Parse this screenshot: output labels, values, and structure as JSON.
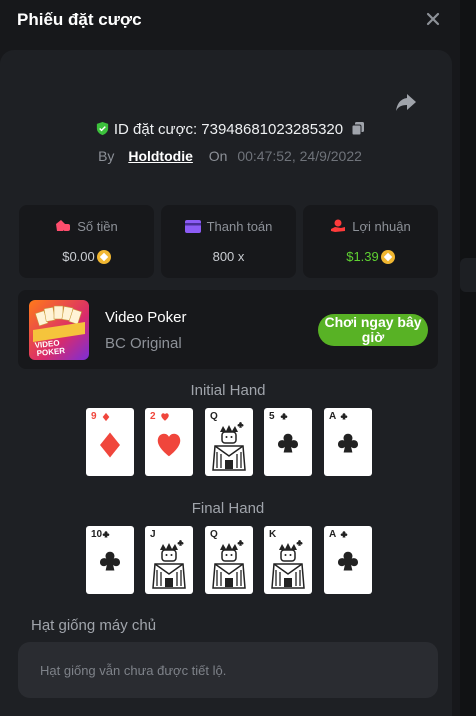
{
  "header": {
    "title": "Phiếu đặt cược",
    "close_icon": "close-icon"
  },
  "bet": {
    "share_icon": "share-icon",
    "verified_icon": "shield-check-icon",
    "copy_icon": "copy-icon",
    "id_label": "ID đặt cược:",
    "id_value": "73948681023285320",
    "by_label": "By",
    "user": "Holdtodie",
    "on_label": "On",
    "time": "00:47:52, 24/9/2022"
  },
  "stats": [
    {
      "icon": "money-bag-icon",
      "label": "Số tiền",
      "value": "$0.00",
      "coin": "coin-icon",
      "color": "#ff4d6d"
    },
    {
      "icon": "wallet-card-icon",
      "label": "Thanh toán",
      "value": "800 x",
      "color": "#8c5cf5"
    },
    {
      "icon": "hand-coin-icon",
      "label": "Lợi nhuận",
      "value": "$1.39",
      "coin": "coin-icon",
      "color": "#ff3b3b",
      "value_color": "#5fd132"
    }
  ],
  "game": {
    "name": "Video Poker",
    "provider": "BC Original",
    "thumb_text": [
      "VIDEO",
      "POKER"
    ],
    "play_label": "Chơi ngay bây giờ"
  },
  "hands": {
    "initial_label": "Initial Hand",
    "initial_cards": [
      {
        "rank": "9",
        "suit": "diamonds"
      },
      {
        "rank": "2",
        "suit": "hearts"
      },
      {
        "rank": "Q",
        "suit": "clubs"
      },
      {
        "rank": "5",
        "suit": "clubs"
      },
      {
        "rank": "A",
        "suit": "clubs"
      }
    ],
    "final_label": "Final Hand",
    "final_cards": [
      {
        "rank": "10",
        "suit": "clubs"
      },
      {
        "rank": "J",
        "suit": "clubs"
      },
      {
        "rank": "Q",
        "suit": "clubs"
      },
      {
        "rank": "K",
        "suit": "clubs"
      },
      {
        "rank": "A",
        "suit": "clubs"
      }
    ]
  },
  "seed": {
    "label": "Hạt giống máy chủ",
    "value": "Hạt giống vẫn chưa được tiết lộ."
  },
  "colors": {
    "accent_green": "#58b225",
    "red_suit": "#f0463c",
    "black_suit": "#222222"
  }
}
